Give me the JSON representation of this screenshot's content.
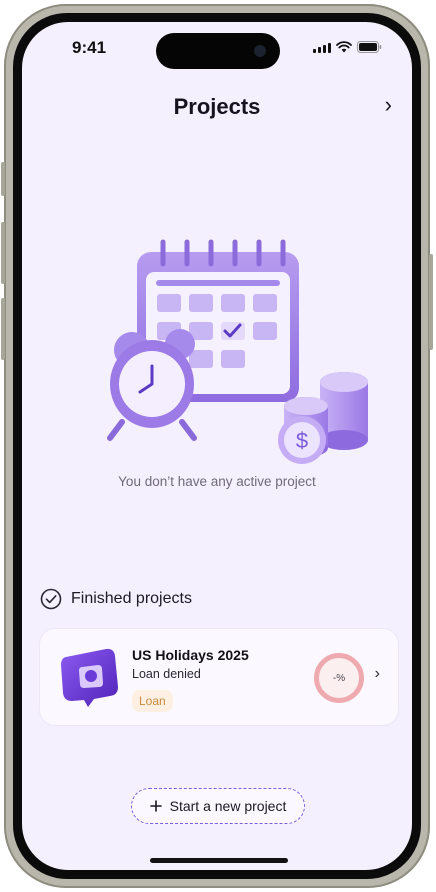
{
  "status_bar": {
    "time": "9:41"
  },
  "header": {
    "title": "Projects",
    "next_icon": "chevron-right-icon"
  },
  "empty_state": {
    "message": "You don’t have any active project"
  },
  "finished": {
    "section_title": "Finished projects",
    "icon": "check-circle-icon",
    "projects": [
      {
        "title": "US Holidays 2025",
        "status": "Loan denied",
        "tag": "Loan",
        "progress_label": "-%"
      }
    ]
  },
  "actions": {
    "start_label": "Start a new project"
  },
  "colors": {
    "background": "#f5f0fd",
    "accent": "#7a5cdc",
    "tag_bg": "#fdf0e2",
    "ring": "#efaab0"
  }
}
